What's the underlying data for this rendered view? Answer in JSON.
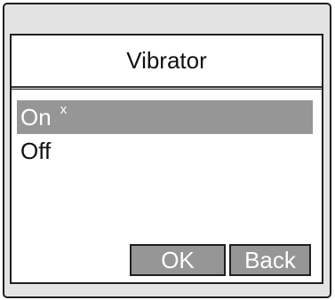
{
  "dialog": {
    "title": "Vibrator",
    "options": [
      {
        "label": "On",
        "mark": "x",
        "selected": true
      },
      {
        "label": "Off",
        "mark": "",
        "selected": false
      }
    ],
    "ok_label": "OK",
    "back_label": "Back"
  },
  "colors": {
    "selection": "#969696",
    "button": "#969696",
    "frame": "#e3e3e3"
  }
}
